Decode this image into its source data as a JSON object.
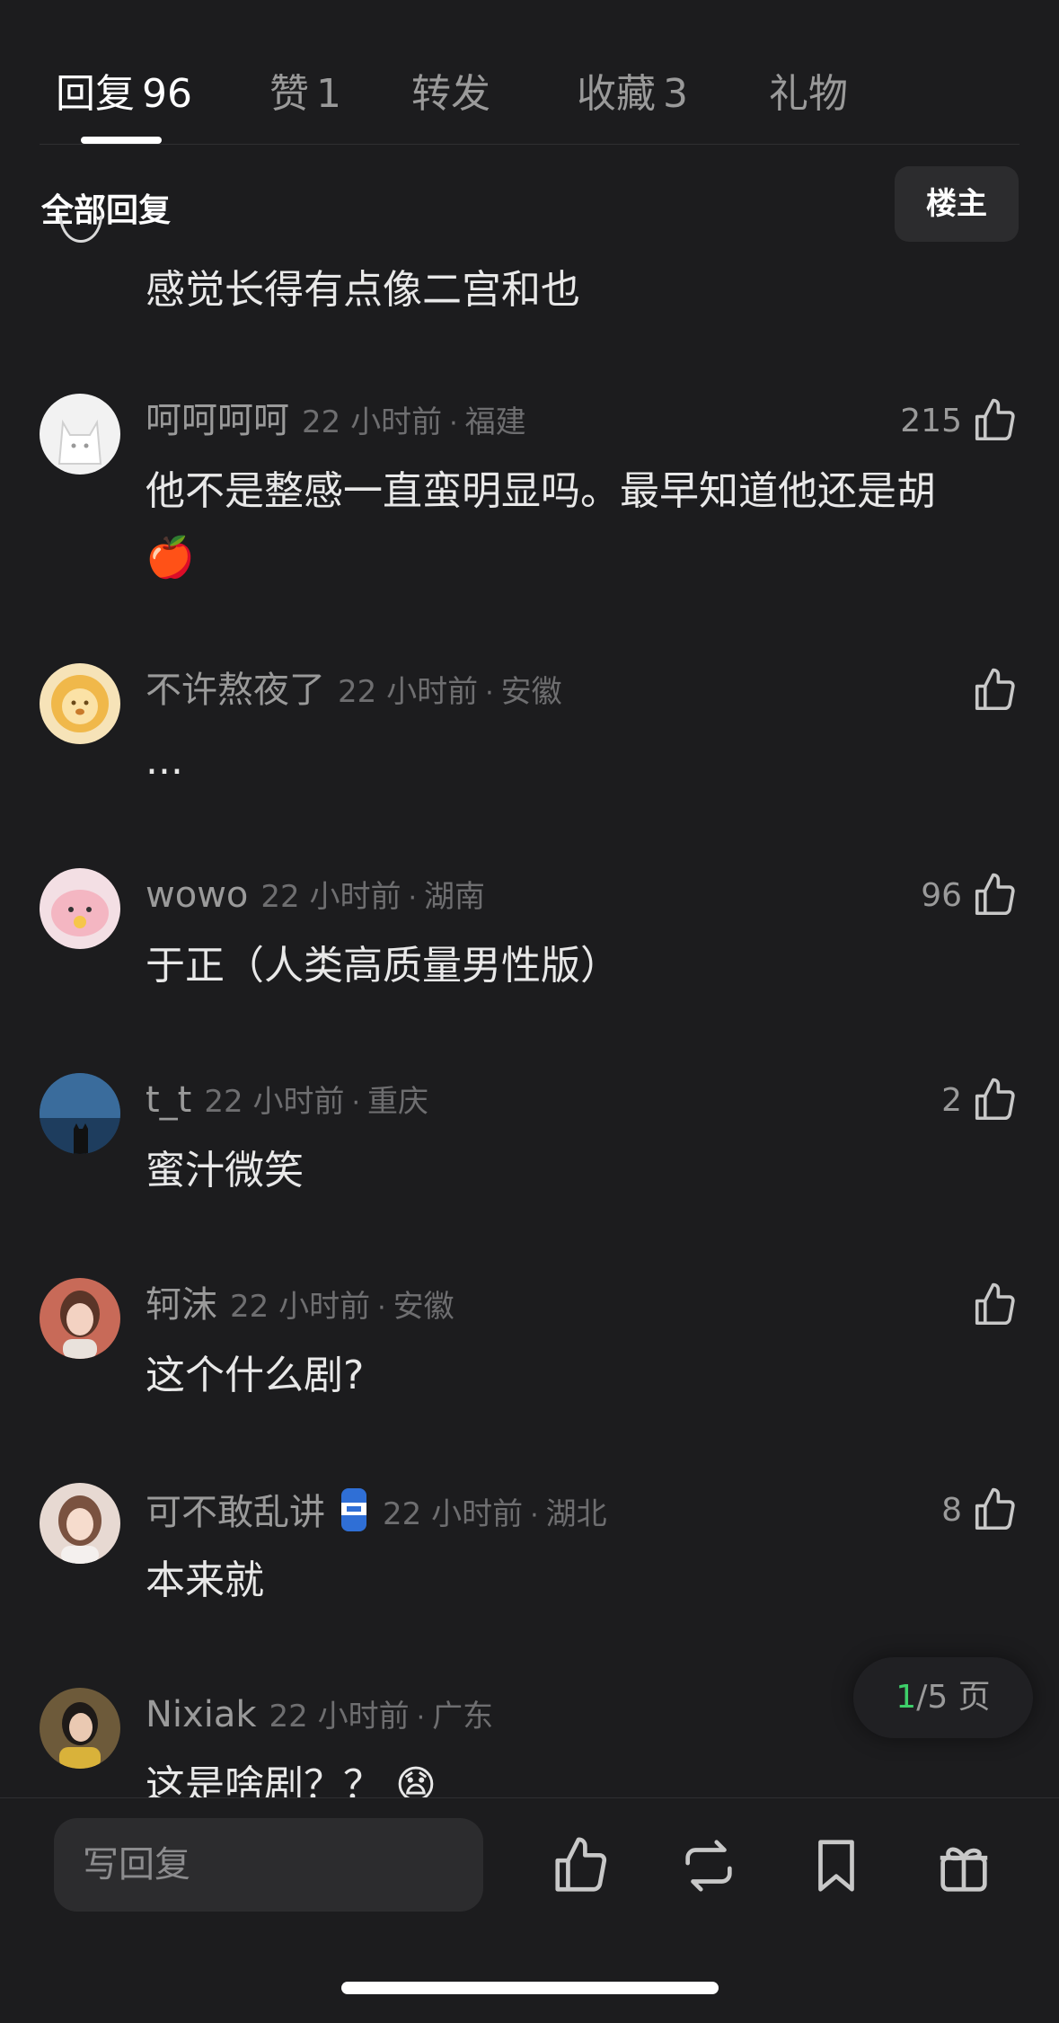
{
  "tabs": [
    {
      "label": "回复",
      "count": "96",
      "active": true
    },
    {
      "label": "赞",
      "count": "1",
      "active": false
    },
    {
      "label": "转发",
      "count": "",
      "active": false
    },
    {
      "label": "收藏",
      "count": "3",
      "active": false
    },
    {
      "label": "礼物",
      "count": "",
      "active": false
    }
  ],
  "section": {
    "title": "全部回复",
    "owner_button": "楼主"
  },
  "partial_comment": {
    "text": "感觉长得有点像二宫和也"
  },
  "comments": [
    {
      "name": "呵呵呵呵",
      "time": "22 小时前",
      "region": "福建",
      "likes": "215",
      "text": "他不是整感一直蛮明显吗。最早知道他还是胡",
      "emoji": "🍎"
    },
    {
      "name": "不许熬夜了",
      "time": "22 小时前",
      "region": "安徽",
      "likes": "",
      "text": "...",
      "emoji": ""
    },
    {
      "name": "wowo",
      "time": "22 小时前",
      "region": "湖南",
      "likes": "96",
      "text": "于正（人类高质量男性版）",
      "emoji": ""
    },
    {
      "name": "t_t",
      "time": "22 小时前",
      "region": "重庆",
      "likes": "2",
      "text": "蜜汁微笑",
      "emoji": ""
    },
    {
      "name": "轲沫",
      "time": "22 小时前",
      "region": "安徽",
      "likes": "",
      "text": "这个什么剧?",
      "emoji": ""
    },
    {
      "name": "可不敢乱讲",
      "time": "22 小时前",
      "region": "湖北",
      "likes": "8",
      "text": "本来就",
      "emoji": ""
    },
    {
      "name": "Nixiak",
      "time": "22 小时前",
      "region": "广东",
      "likes": "",
      "text": "这是啥剧？？",
      "emoji": "😧"
    }
  ],
  "pager": {
    "current": "1",
    "total_suffix": "/5 页"
  },
  "bottom_bar": {
    "reply_placeholder": "写回复"
  },
  "dot_separator": "·",
  "icons": {
    "like": "thumbs-up-icon",
    "repost": "repost-icon",
    "bookmark": "bookmark-icon",
    "gift": "gift-icon"
  },
  "colors": {
    "background": "#1c1c1e",
    "pager_current": "#3ecf6a",
    "text_secondary": "#9a9a9a"
  }
}
